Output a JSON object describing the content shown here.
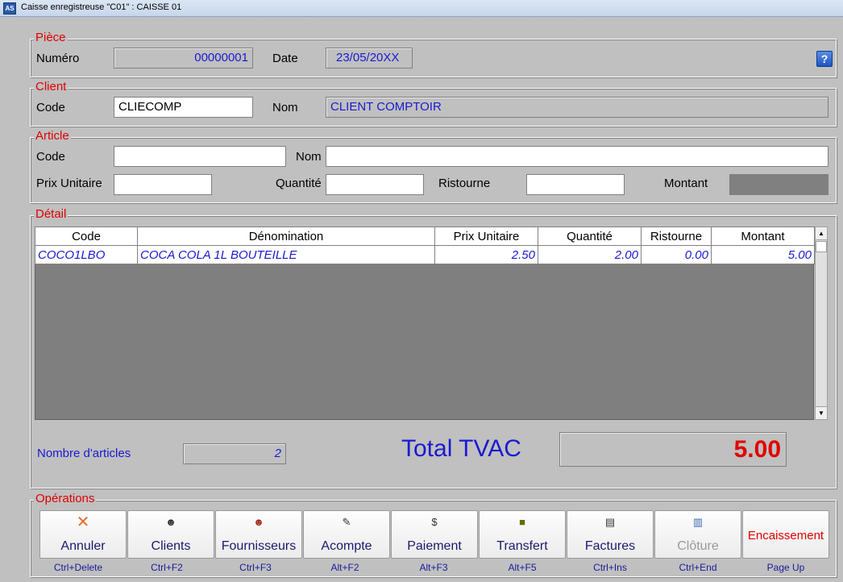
{
  "window": {
    "title": "Caisse enregistreuse \"C01\" : CAISSE 01",
    "app_icon": "app-icon"
  },
  "piece": {
    "legend": "Pièce",
    "numero_label": "Numéro",
    "numero_value": "00000001",
    "date_label": "Date",
    "date_value": "23/05/20XX",
    "help_label": "?"
  },
  "client": {
    "legend": "Client",
    "code_label": "Code",
    "code_value": "CLIECOMP",
    "nom_label": "Nom",
    "nom_value": "CLIENT COMPTOIR"
  },
  "article": {
    "legend": "Article",
    "code_label": "Code",
    "code_value": "",
    "nom_label": "Nom",
    "nom_value": "",
    "prix_label": "Prix Unitaire",
    "prix_value": "",
    "quantite_label": "Quantité",
    "quantite_value": "",
    "ristourne_label": "Ristourne",
    "ristourne_value": "",
    "montant_label": "Montant"
  },
  "detail": {
    "legend": "Détail",
    "columns": [
      "Code",
      "Dénomination",
      "Prix Unitaire",
      "Quantité",
      "Ristourne",
      "Montant"
    ],
    "rows": [
      {
        "code": "COCO1LBO",
        "denomination": "COCA COLA 1L BOUTEILLE",
        "prix": "2.50",
        "quantite": "2.00",
        "ristourne": "0.00",
        "montant": "5.00"
      }
    ]
  },
  "summary": {
    "nombre_label": "Nombre d'articles",
    "nombre_value": "2",
    "total_label": "Total TVAC",
    "total_value": "5.00"
  },
  "operations": {
    "legend": "Opérations",
    "buttons": [
      {
        "label": "Annuler",
        "shortcut": "Ctrl+Delete",
        "icon": "cancel-icon"
      },
      {
        "label": "Clients",
        "shortcut": "Ctrl+F2",
        "icon": "clients-icon"
      },
      {
        "label": "Fournisseurs",
        "shortcut": "Ctrl+F3",
        "icon": "suppliers-icon"
      },
      {
        "label": "Acompte",
        "shortcut": "Alt+F2",
        "icon": "receipt-icon"
      },
      {
        "label": "Paiement",
        "shortcut": "Alt+F3",
        "icon": "payment-icon"
      },
      {
        "label": "Transfert",
        "shortcut": "Alt+F5",
        "icon": "transfer-icon"
      },
      {
        "label": "Factures",
        "shortcut": "Ctrl+Ins",
        "icon": "invoices-icon"
      },
      {
        "label": "Clôture",
        "shortcut": "Ctrl+End",
        "icon": "closing-icon",
        "disabled": true
      },
      {
        "label": "Encaissement",
        "shortcut": "Page Up"
      }
    ]
  },
  "colors": {
    "legend": "#e00000",
    "value_text": "#1a1ad0",
    "total": "#e00000",
    "background": "#c0c0c0"
  }
}
